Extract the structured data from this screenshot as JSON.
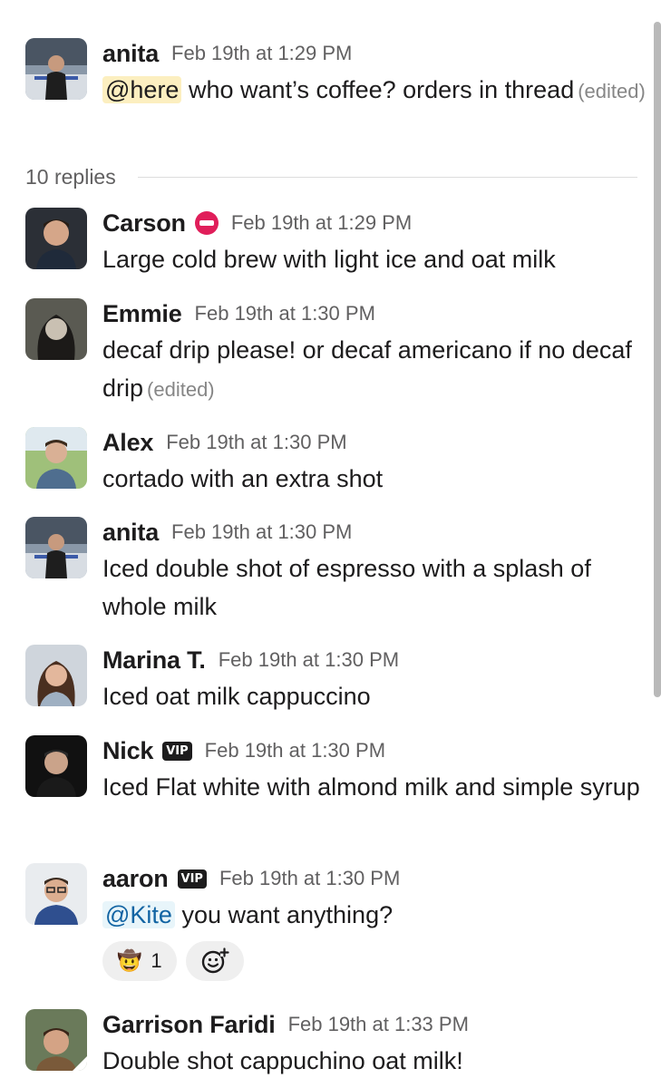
{
  "parent": {
    "author": "anita",
    "timestamp": "Feb 19th at 1:29 PM",
    "mention": "@here",
    "text": " who want’s coffee? orders in thread",
    "edited": "(edited)"
  },
  "replies_label": "10 replies",
  "replies": [
    {
      "author": "Carson",
      "timestamp": "Feb 19th at 1:29 PM",
      "text": "Large cold brew with light ice and oat milk",
      "status_icon": "do-not-disturb-icon"
    },
    {
      "author": "Emmie",
      "timestamp": "Feb 19th at 1:30 PM",
      "text": "decaf drip please! or decaf americano if no decaf drip",
      "edited": "(edited)"
    },
    {
      "author": "Alex",
      "timestamp": "Feb 19th at 1:30 PM",
      "text": "cortado with an extra shot"
    },
    {
      "author": "anita",
      "timestamp": "Feb 19th at 1:30 PM",
      "text": "Iced double shot of espresso with a splash of whole milk"
    },
    {
      "author": "Marina T.",
      "timestamp": "Feb 19th at 1:30 PM",
      "text": "Iced oat milk cappuccino"
    },
    {
      "author": "Nick",
      "badge": "VIP",
      "timestamp": "Feb 19th at 1:30 PM",
      "text": "Iced Flat white with almond milk and simple syrup"
    },
    {
      "author": "aaron",
      "badge": "VIP",
      "timestamp": "Feb 19th at 1:30 PM",
      "mention": "@Kite",
      "text": " you want anything?",
      "reaction": {
        "emoji": "🤠",
        "icon": "cowboy-face-icon",
        "count": "1"
      },
      "add_reaction_icon": "add-reaction-icon"
    },
    {
      "author": "Garrison Faridi",
      "timestamp": "Feb 19th at 1:33 PM",
      "text": "Double shot cappuchino oat milk!"
    }
  ],
  "colors": {
    "text": "#1d1c1d",
    "timestamp": "#616061",
    "here_mention_bg": "#fcefc0",
    "user_mention_bg": "#e8f5fa",
    "user_mention_text": "#1264a3",
    "dnd_red": "#e01e5a"
  }
}
